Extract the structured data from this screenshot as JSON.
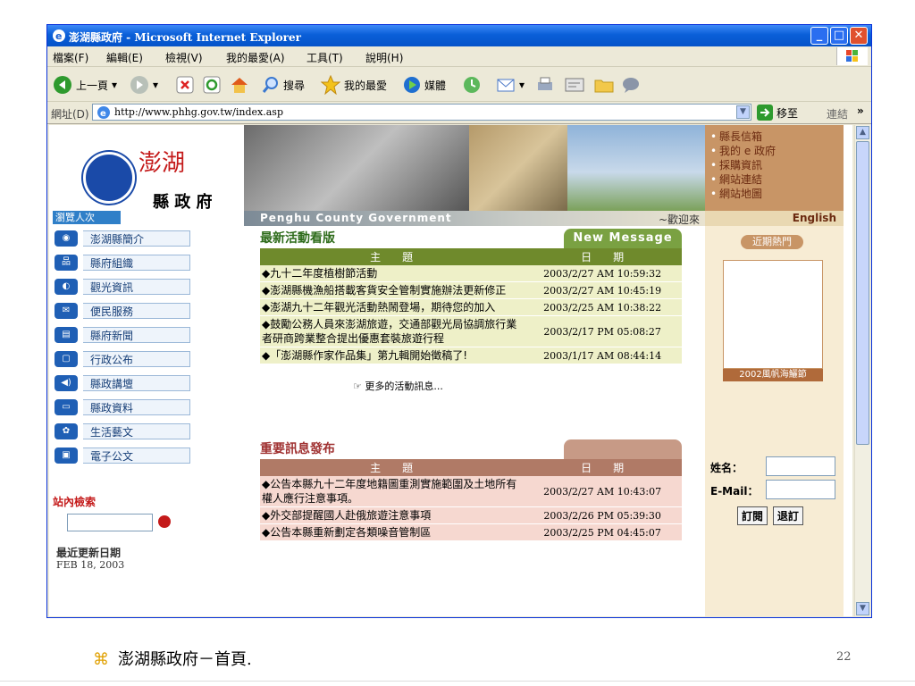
{
  "window": {
    "title": "澎湖縣政府 - Microsoft Internet Explorer"
  },
  "menu": [
    "檔案(F)",
    "編輯(E)",
    "檢視(V)",
    "我的最愛(A)",
    "工具(T)",
    "說明(H)"
  ],
  "toolbar": {
    "back": "上一頁",
    "search": "搜尋",
    "favorites": "我的最愛",
    "media": "媒體"
  },
  "address": {
    "label": "網址(D)",
    "url": "http://www.phhg.gov.tw/index.asp",
    "go": "移至",
    "links": "連結"
  },
  "logo": {
    "name_top": "澎湖",
    "name_bottom": "縣 政 府"
  },
  "visitor_label": "瀏覽人次",
  "nav": [
    {
      "label": "澎湖縣簡介",
      "icon": "seal-icon"
    },
    {
      "label": "縣府組織",
      "icon": "org-chart-icon"
    },
    {
      "label": "觀光資訊",
      "icon": "tourism-icon"
    },
    {
      "label": "便民服務",
      "icon": "service-icon"
    },
    {
      "label": "縣府新聞",
      "icon": "news-icon"
    },
    {
      "label": "行政公布",
      "icon": "notice-icon"
    },
    {
      "label": "縣政講壇",
      "icon": "speaker-icon"
    },
    {
      "label": "縣政資料",
      "icon": "data-icon"
    },
    {
      "label": "生活藝文",
      "icon": "arts-icon"
    },
    {
      "label": "電子公文",
      "icon": "document-icon"
    }
  ],
  "site_search": {
    "title": "站內檢索"
  },
  "last_update": {
    "label": "最近更新日期",
    "date": "FEB 18, 2003"
  },
  "banner": {
    "english": "Penghu County Government",
    "welcome": "~歡迎來"
  },
  "right_links": [
    "縣長信箱",
    "我的 e 政府",
    "採購資訊",
    "網站連結",
    "網站地圖"
  ],
  "right_english": "English",
  "news": {
    "title": "最新活動看版",
    "tag": "New Message",
    "header_subject": "主　　題",
    "header_date": "日　　期",
    "rows": [
      {
        "subject": "◆九十二年度植樹節活動",
        "date": "2003/2/27 AM 10:59:32"
      },
      {
        "subject": "◆澎湖縣機漁船搭載客貨安全管制實施辦法更新修正",
        "date": "2003/2/27 AM 10:45:19"
      },
      {
        "subject": "◆澎湖九十二年觀光活動熱鬧登場，期待您的加入",
        "date": "2003/2/25 AM 10:38:22"
      },
      {
        "subject": "◆鼓勵公務人員來澎湖旅遊，交通部觀光局協調旅行業者研商跨業整合提出優惠套裝旅遊行程",
        "date": "2003/2/17 PM 05:08:27"
      },
      {
        "subject": "◆「澎湖縣作家作品集」第九輯開始徵稿了!",
        "date": "2003/1/17 AM 08:44:14"
      }
    ],
    "more": "更多的活動訊息..."
  },
  "important": {
    "title": "重要訊息發布",
    "header_subject": "主　　題",
    "header_date": "日　　期",
    "rows": [
      {
        "subject": "◆公告本縣九十二年度地籍圖重測實施範圍及土地所有權人應行注意事項。",
        "date": "2003/2/27 AM 10:43:07"
      },
      {
        "subject": "◆外交部提醒國人赴俄旅遊注意事項",
        "date": "2003/2/26 PM 05:39:30"
      },
      {
        "subject": "◆公告本縣重新劃定各類噪音管制區",
        "date": "2003/2/25 PM 04:45:07"
      }
    ]
  },
  "hot": {
    "title": "近期熱門",
    "caption": "2002風帆海鱺節"
  },
  "subscribe": {
    "name_label": "姓名：",
    "email_label": "E-Mail：",
    "subscribe_btn": "訂閱",
    "unsubscribe_btn": "退訂"
  },
  "slide": {
    "caption": "澎湖縣政府－首頁.",
    "page": "22"
  }
}
